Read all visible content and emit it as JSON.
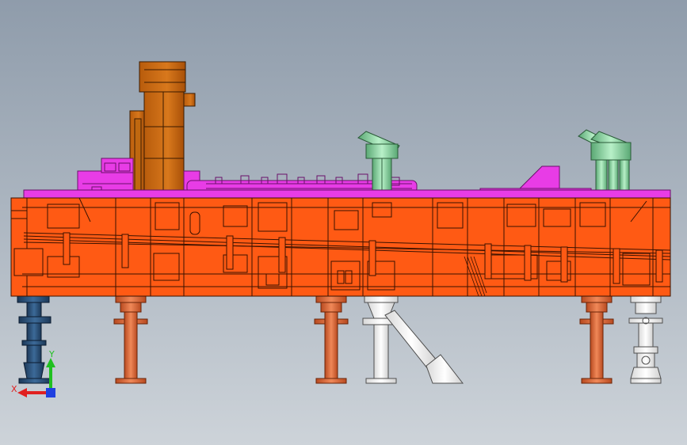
{
  "viewport": {
    "background_top": "#8f9cab",
    "background_bottom": "#cdd3d9"
  },
  "model": {
    "base_color": "#ff5a14",
    "top_plate_color": "#e83ce6",
    "block_color": "#cc6a10",
    "pin_color": "#f07040",
    "green_post_color": "#8ed9a2",
    "white_post_color": "#f4f4f4",
    "dark_post_color": "#2a4a70"
  },
  "triad": {
    "x_label": "X",
    "y_label": "Y",
    "x_color": "#e02020",
    "y_color": "#20c020",
    "z_color": "#2040e0"
  }
}
